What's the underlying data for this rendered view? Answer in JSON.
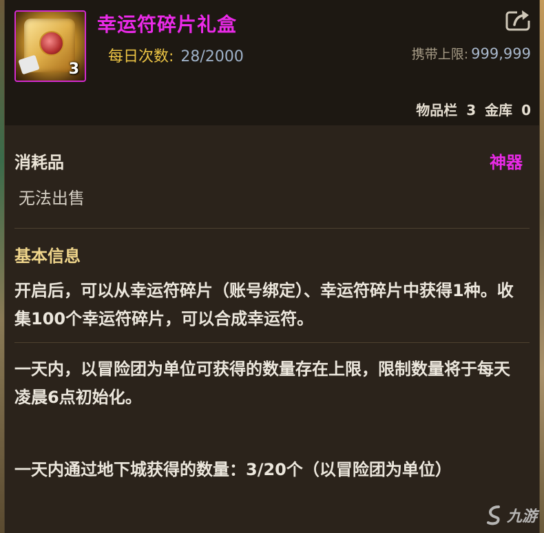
{
  "item": {
    "name": "幸运符碎片礼盒",
    "icon": "lucky-charm-fragment-box-icon",
    "stack_count": "3",
    "daily_label": "每日次数:",
    "daily_value": "28/2000",
    "carry_label": "携带上限:",
    "carry_value": "999,999",
    "inventory_label": "物品栏",
    "inventory_count": "3",
    "vault_label": "金库",
    "vault_count": "0"
  },
  "properties": {
    "category": "消耗品",
    "rarity": "神器",
    "sell_status": "无法出售"
  },
  "info": {
    "section_title": "基本信息",
    "paragraph1": "开启后，可以从幸运符碎片（账号绑定）、幸运符碎片中获得1种。收集100个幸运符碎片，可以合成幸运符。",
    "paragraph2": "一天内，以冒险团为单位可获得的数量存在上限，限制数量将于每天凌晨6点初始化。",
    "paragraph3": "一天内通过地下城获得的数量：3/20个（以冒险团为单位）"
  },
  "watermark": {
    "text": "九游"
  },
  "colors": {
    "name_color": "#ea2ae8",
    "rarity_color": "#ea2ae8",
    "daily_label_color": "#ecc445",
    "section_title_color": "#f0d68c"
  }
}
